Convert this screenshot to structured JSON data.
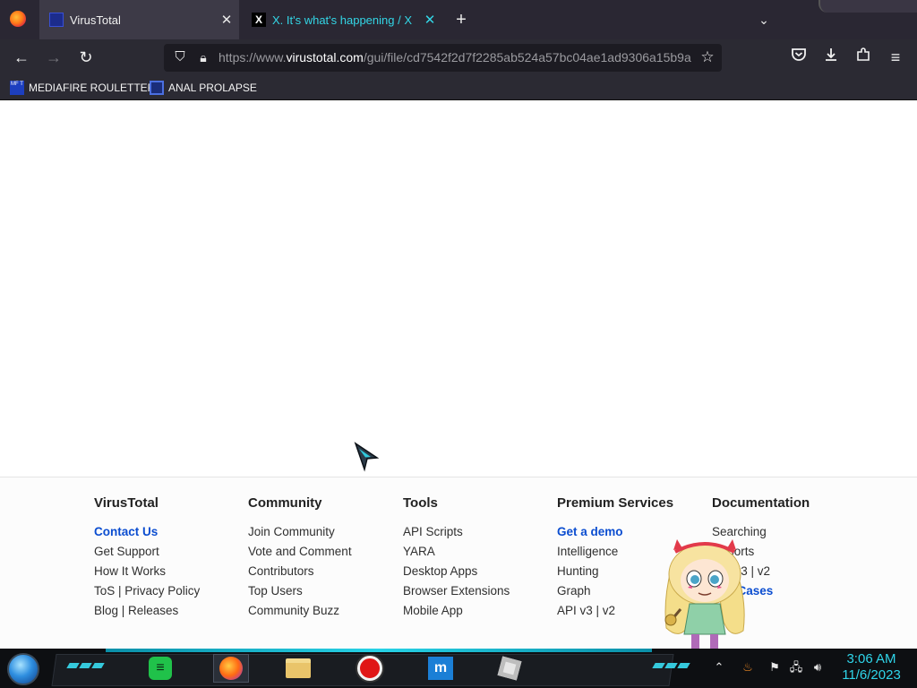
{
  "browser": {
    "tabs": [
      {
        "title": "VirusTotal",
        "icon": "virustotal-icon",
        "active": true
      },
      {
        "title": "X. It's what's happening / X",
        "icon": "x-logo-icon",
        "active": false
      }
    ],
    "x_favicon_glyph": "X",
    "url": {
      "prefix": "https://www.",
      "domain": "virustotal.com",
      "path": "/gui/file/cd7542f2d7f2285ab524a57bc04ae1ad9306a15b9a"
    },
    "bookmarks": [
      {
        "label": "MEDIAFIRE ROULETTER",
        "icon_text": "MF T"
      },
      {
        "label": "ANAL PROLAPSE"
      }
    ],
    "accent_color": "#33d6e6"
  },
  "footer": {
    "columns": [
      {
        "heading": "VirusTotal",
        "links": [
          {
            "label": "Contact Us",
            "highlight": true
          },
          {
            "label": "Get Support"
          },
          {
            "label": "How It Works"
          },
          {
            "label": "ToS | Privacy Policy"
          },
          {
            "label": "Blog | Releases"
          }
        ]
      },
      {
        "heading": "Community",
        "links": [
          {
            "label": "Join Community"
          },
          {
            "label": "Vote and Comment"
          },
          {
            "label": "Contributors"
          },
          {
            "label": "Top Users"
          },
          {
            "label": "Community Buzz"
          }
        ]
      },
      {
        "heading": "Tools",
        "links": [
          {
            "label": "API Scripts"
          },
          {
            "label": "YARA"
          },
          {
            "label": "Desktop Apps"
          },
          {
            "label": "Browser Extensions"
          },
          {
            "label": "Mobile App"
          }
        ]
      },
      {
        "heading": "Premium Services",
        "links": [
          {
            "label": "Get a demo",
            "highlight": true
          },
          {
            "label": "Intelligence"
          },
          {
            "label": "Hunting"
          },
          {
            "label": "Graph"
          },
          {
            "label": "API v3 | v2"
          }
        ]
      },
      {
        "heading": "Documentation",
        "links": [
          {
            "label": "Searching"
          },
          {
            "label": "Reports"
          },
          {
            "label": "API v3 | v2"
          },
          {
            "label": "Use Cases",
            "highlight": true
          }
        ]
      }
    ],
    "link_color": "#0b4dd0"
  },
  "taskbar": {
    "apps": [
      "spotify-icon",
      "firefox-icon",
      "file-explorer-icon",
      "record-icon",
      "maxthon-icon",
      "roblox-icon"
    ],
    "maxthon_glyph": "m",
    "tray_icons": [
      "java-icon",
      "flag-icon",
      "network-icon",
      "volume-icon"
    ],
    "clock": {
      "time": "3:06 AM",
      "date": "11/6/2023"
    },
    "accent_color": "#2fd5ea"
  }
}
